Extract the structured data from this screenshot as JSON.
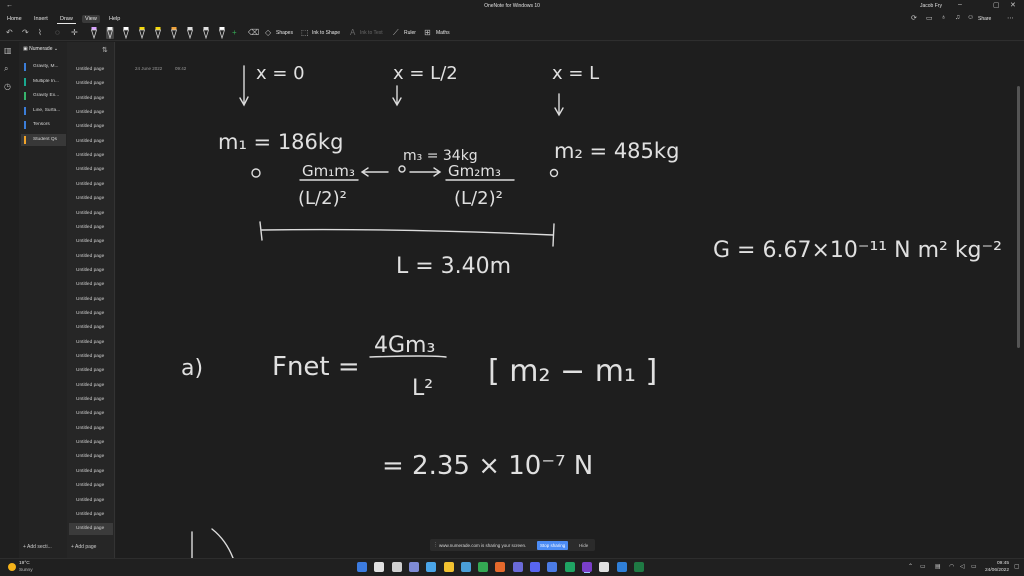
{
  "window": {
    "title": "OneNote for Windows 10",
    "user": "Jacob Fry",
    "back_glyph": "←",
    "min_glyph": "–",
    "max_glyph": "▢",
    "close_glyph": "✕"
  },
  "ribbon": {
    "tabs": [
      "Home",
      "Insert",
      "Draw",
      "View",
      "Help"
    ],
    "share_label": "Share"
  },
  "toolbar": {
    "shapes_label": "Shapes",
    "ink_to_shape_label": "Ink to Shape",
    "ink_to_text_label": "Ink to Text",
    "ruler_label": "Ruler",
    "maths_label": "Maths",
    "pen_colors": [
      "#d9a3ff",
      "#f2f2f2",
      "#ffffff",
      "#f5d90a",
      "#f5d90a",
      "#f2a33a",
      "#e0e0e0",
      "#e0e0e0",
      "#ffffff"
    ]
  },
  "notebook": {
    "name": "Numerade",
    "sections": [
      {
        "label": "Gravity, M...",
        "color": "#3b7dd8"
      },
      {
        "label": "Multiple In...",
        "color": "#19a88f"
      },
      {
        "label": "Gravity Ex...",
        "color": "#37b46c"
      },
      {
        "label": "Line, Surfa...",
        "color": "#3b7dd8"
      },
      {
        "label": "Tensors",
        "color": "#3b7dd8"
      },
      {
        "label": "Student Qs",
        "color": "#f0a32a"
      }
    ],
    "add_section_label": "Add secti..."
  },
  "pages": {
    "items": [
      "Untitled page",
      "Untitled page",
      "Untitled page",
      "Untitled page",
      "Untitled page",
      "Untitled page",
      "Untitled page",
      "Untitled page",
      "Untitled page",
      "Untitled page",
      "Untitled page",
      "Untitled page",
      "Untitled page",
      "Untitled page",
      "Untitled page",
      "Untitled page",
      "Untitled page",
      "Untitled page",
      "Untitled page",
      "Untitled page",
      "Untitled page",
      "Untitled page",
      "Untitled page",
      "Untitled page",
      "Untitled page",
      "Untitled page",
      "Untitled page",
      "Untitled page",
      "Untitled page",
      "Untitled page",
      "Untitled page",
      "Untitled page",
      "Untitled page"
    ],
    "add_page_label": "Add page"
  },
  "note": {
    "date": "24 June 2022",
    "time": "09:42",
    "ink_x0": "x = 0",
    "ink_xhalf": "x = L/2",
    "ink_xl": "x = L",
    "ink_m1": "m₁ = 186kg",
    "ink_m3": "m₃ = 34kg",
    "ink_m2": "m₂ = 485kg",
    "ink_f1_num": "Gm₁m₃",
    "ink_f1_den": "(L/2)²",
    "ink_f2_num": "Gm₂m₃",
    "ink_f2_den": "(L/2)²",
    "ink_length": "L = 3.40m",
    "ink_G": "G = 6.67×10⁻¹¹ N m² kg⁻²",
    "ink_part_a": "a)",
    "ink_fnet": "Fnet =",
    "ink_frac_num": "4Gm₃",
    "ink_frac_den": "L²",
    "ink_bracket": "[ m₂ − m₁ ]",
    "ink_result": "= 2.35 × 10⁻⁷ N"
  },
  "sharing": {
    "message": "www.numerade.com is sharing your screen.",
    "stop_label": "Stop sharing",
    "hide_label": "Hide"
  },
  "taskbar": {
    "temperature": "19°C",
    "condition": "Sunny",
    "time": "09:45",
    "date": "24/06/2022",
    "app_colors": [
      "#3c7be0",
      "#e0e0e0",
      "#d0d0d0",
      "#7f8bd6",
      "#4aa5e8",
      "#f2c230",
      "#4a9fd8",
      "#34a853",
      "#e66a2c",
      "#6a6ad8",
      "#5865f2",
      "#4b7be5",
      "#1fa463",
      "#7a3fc9",
      "#e0e0e0",
      "#2f7fd8",
      "#1f7a44"
    ]
  }
}
